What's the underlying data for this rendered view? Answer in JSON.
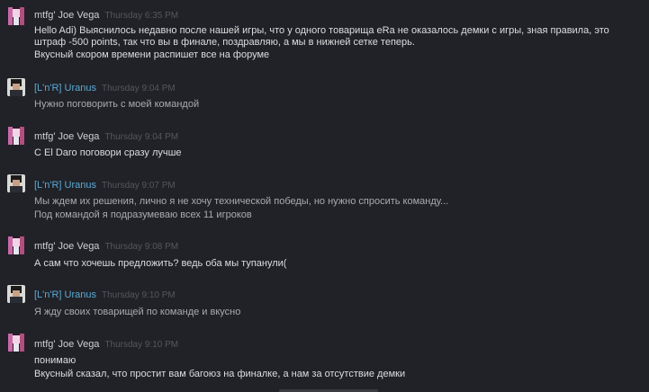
{
  "messages": [
    {
      "author": "mtfg' Joe Vega",
      "time": "Thursday 6:35 PM",
      "lines": [
        "Hello Adi) Выяснилось недавно после нашей игры, что у одного товарища eRa не оказалось демки с игры, зная правила, это",
        "штраф -500 points, так что вы в финале, поздравляю, а мы в нижней сетке теперь.",
        "Вкусный скором времени распишет все на форуме"
      ]
    },
    {
      "author": "[L'n'R] Uranus",
      "time": "Thursday 9:04 PM",
      "lines": [
        "Нужно поговорить с моей командой"
      ]
    },
    {
      "author": "mtfg' Joe Vega",
      "time": "Thursday 9:04 PM",
      "lines": [
        "С El Daro поговори сразу лучше"
      ]
    },
    {
      "author": "[L'n'R] Uranus",
      "time": "Thursday 9:07 PM",
      "lines": [
        "Мы ждем их решения, лично я не хочу технической победы, но нужно спросить команду...",
        "Под командой я подразумеваю всех 11 игроков"
      ]
    },
    {
      "author": "mtfg' Joe Vega",
      "time": "Thursday 9:08 PM",
      "lines": [
        "А сам что хочешь предложить? ведь оба мы тупанули("
      ]
    },
    {
      "author": "[L'n'R] Uranus",
      "time": "Thursday 9:10 PM",
      "lines": [
        "Я жду своих товарищей по команде и вкусно"
      ]
    },
    {
      "author": "mtfg' Joe Vega",
      "time": "Thursday 9:10 PM",
      "lines": [
        "понимаю",
        "Вкусный сказал, что простит вам багоюз на финалке, а нам за отсутствие демки"
      ]
    }
  ],
  "colors": {
    "background": "#202227",
    "joe_name": "#cfd0d2",
    "uranus_name": "#5ba9d6",
    "timestamp": "#55575c",
    "joe_text": "#dcdddf",
    "uranus_text": "#a9abaf"
  },
  "icons": {
    "joe_avatar": "pink-figure-avatar-icon",
    "uranus_avatar": "dark-haired-person-avatar-icon"
  }
}
